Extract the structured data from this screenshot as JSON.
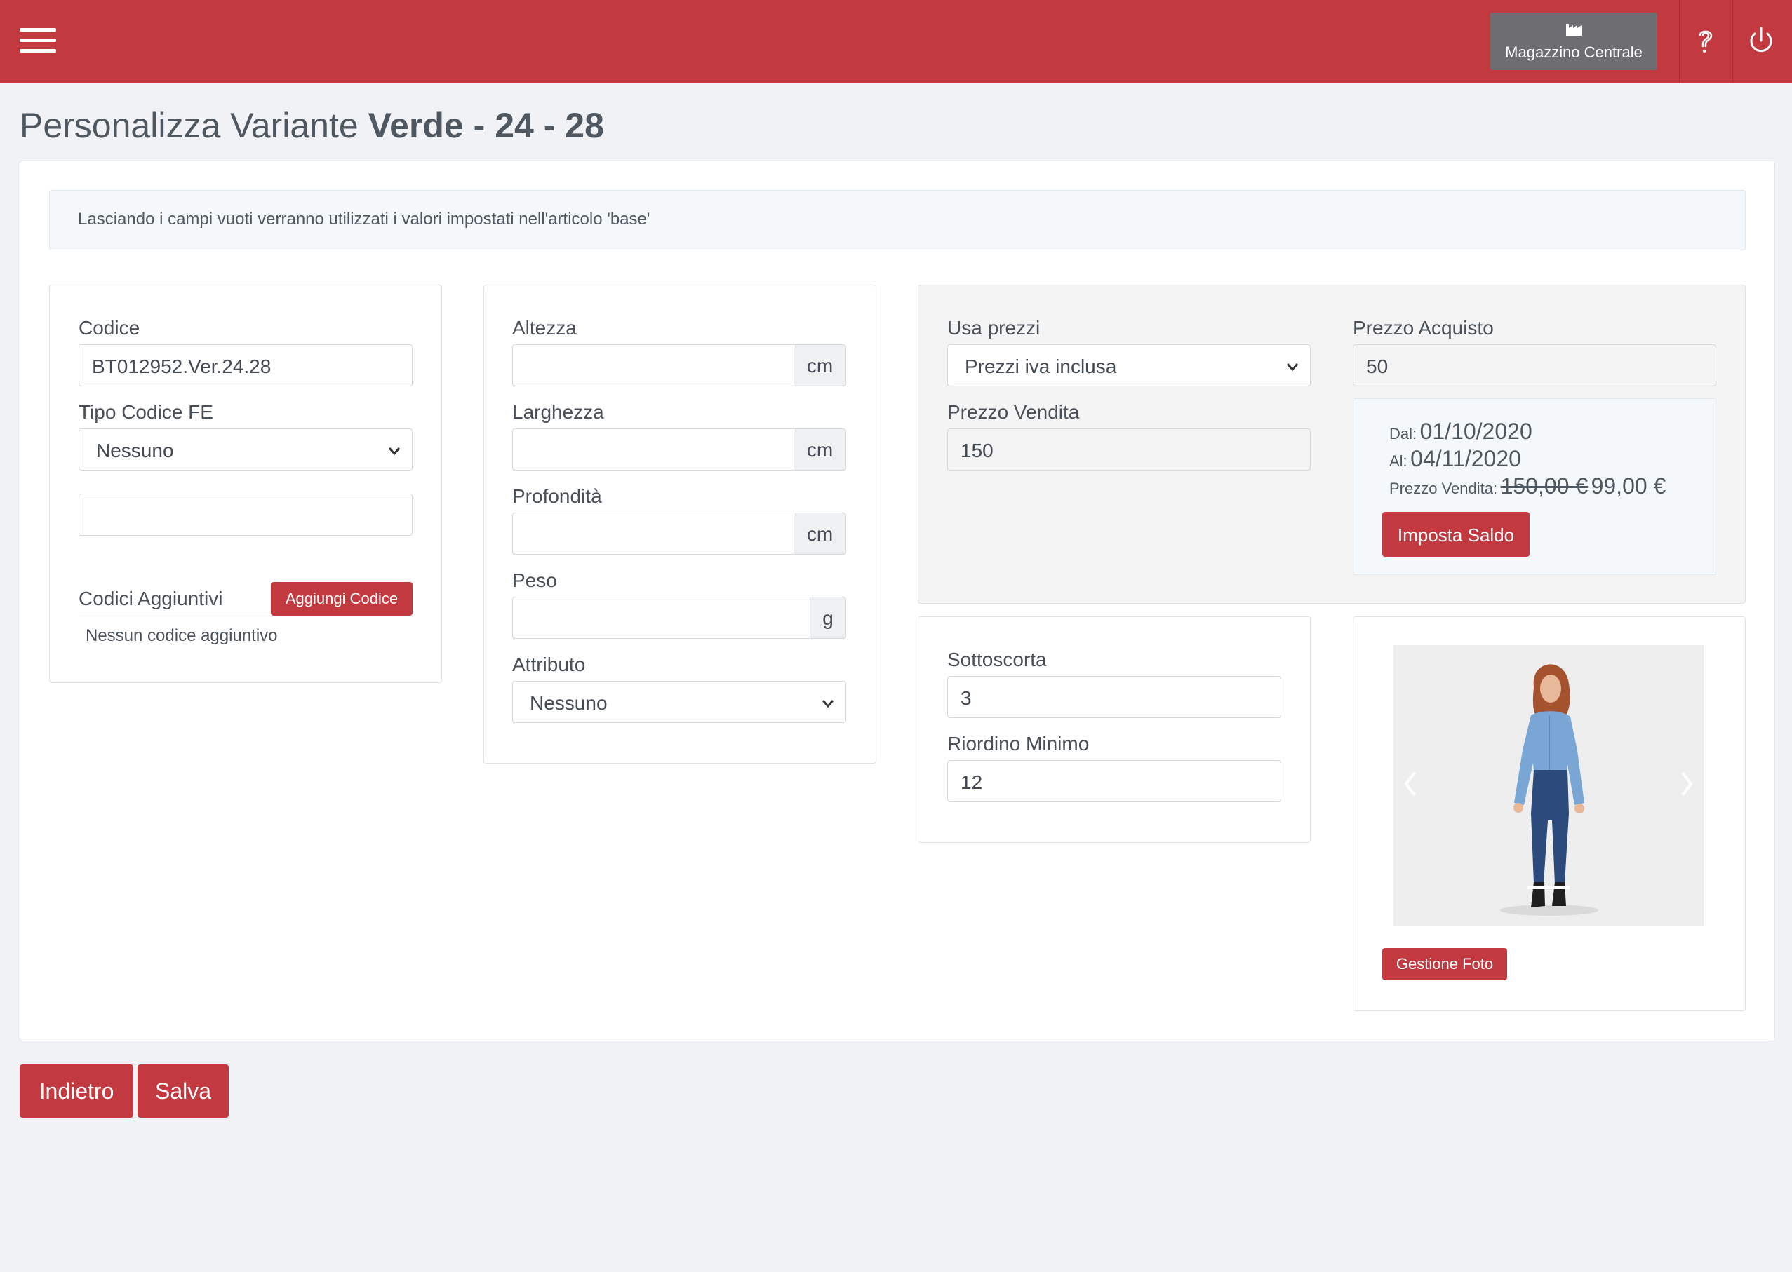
{
  "header": {
    "warehouse_label": "Magazzino Centrale",
    "menu_icon": "hamburger-menu-icon",
    "warehouse_icon": "factory-icon",
    "help_icon": "help-icon",
    "power_icon": "power-icon",
    "brand_color": "#c23940"
  },
  "page": {
    "title_prefix": "Personalizza Variante",
    "title_variant": "Verde - 24 - 28"
  },
  "alert": {
    "text": "Lasciando i campi vuoti verranno utilizzati i valori impostati nell'articolo 'base'"
  },
  "codes_panel": {
    "codice_label": "Codice",
    "codice_value": "BT012952.Ver.24.28",
    "tipo_label": "Tipo Codice FE",
    "tipo_value": "Nessuno",
    "extra_value": "",
    "aggiuntivi_label": "Codici Aggiuntivi",
    "add_button": "Aggiungi Codice",
    "empty_text": "Nessun codice aggiuntivo"
  },
  "dimensions_panel": {
    "altezza_label": "Altezza",
    "altezza_value": "",
    "altezza_unit": "cm",
    "larghezza_label": "Larghezza",
    "larghezza_value": "",
    "larghezza_unit": "cm",
    "profondita_label": "Profondità",
    "profondita_value": "",
    "profondita_unit": "cm",
    "peso_label": "Peso",
    "peso_value": "",
    "peso_unit": "g",
    "attributo_label": "Attributo",
    "attributo_value": "Nessuno"
  },
  "prices_panel": {
    "usa_prezzi_label": "Usa prezzi",
    "usa_prezzi_value": "Prezzi iva inclusa",
    "prezzo_vendita_label": "Prezzo Vendita",
    "prezzo_vendita_value": "150",
    "prezzo_acquisto_label": "Prezzo Acquisto",
    "prezzo_acquisto_value": "50",
    "sale": {
      "dal_label": "Dal:",
      "dal_value": "01/10/2020",
      "al_label": "Al:",
      "al_value": "04/11/2020",
      "prezzo_label": "Prezzo Vendita:",
      "old_price": "150,00 €",
      "new_price": "99,00 €",
      "button": "Imposta Saldo"
    }
  },
  "stock_panel": {
    "sottoscorta_label": "Sottoscorta",
    "sottoscorta_value": "3",
    "riordino_label": "Riordino Minimo",
    "riordino_value": "12"
  },
  "photo_panel": {
    "button": "Gestione Foto",
    "prev_icon": "chevron-left-icon",
    "next_icon": "chevron-right-icon"
  },
  "footer": {
    "back_button": "Indietro",
    "save_button": "Salva"
  }
}
